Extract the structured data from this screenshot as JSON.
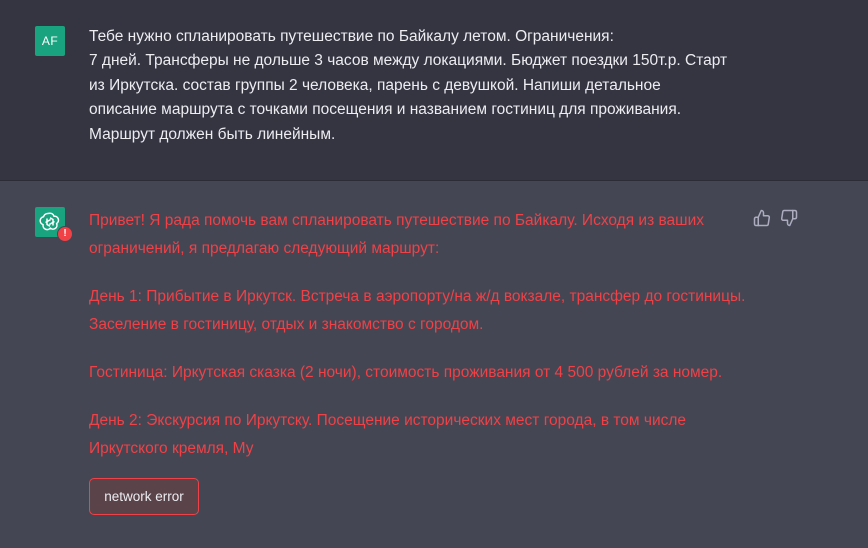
{
  "user_message": {
    "avatar_initials": "AF",
    "text": "Тебе нужно спланировать путешествие по Байкалу летом. Ограничения:\n7 дней. Трансферы не дольше 3 часов между локациями. Бюджет поездки 150т.р. Старт\nиз Иркутска. состав группы 2 человека, парень с девушкой. Напиши детальное\nописание маршрута с точками посещения и названием гостиниц для проживания.\nМаршрут должен быть линейным."
  },
  "assistant_message": {
    "avatar_icon": "chatgpt-logo-icon",
    "error_badge": "!",
    "paragraphs": [
      "Привет! Я рада помочь вам спланировать путешествие по Байкалу. Исходя из ваших ограничений, я предлагаю следующий маршрут:",
      "День 1: Прибытие в Иркутск. Встреча в аэропорту/на ж/д вокзале, трансфер до гостиницы. Заселение в гостиницу, отдых и знакомство с городом.",
      "Гостиница: Иркутская сказка (2 ночи), стоимость проживания от 4 500 рублей за номер.",
      "День 2: Экскурсия по Иркутску. Посещение исторических мест города, в том числе Иркутского кремля, Му"
    ],
    "error_text": "network error"
  },
  "colors": {
    "user_bg": "#343541",
    "assistant_bg": "#444654",
    "error_red": "#ef4146",
    "avatar_green": "#1aa37f"
  },
  "icons": {
    "thumbs_up": "thumbs-up-icon",
    "thumbs_down": "thumbs-down-icon"
  }
}
